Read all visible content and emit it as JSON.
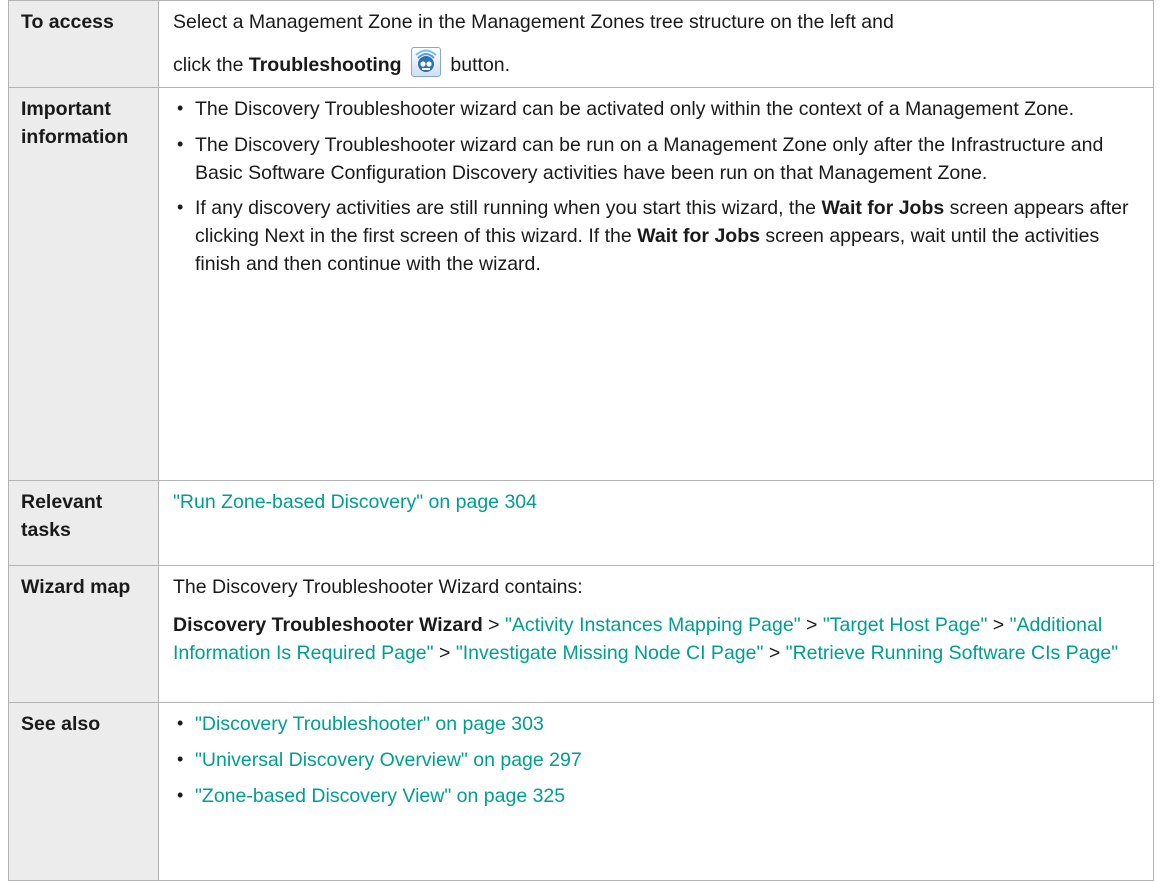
{
  "rows": {
    "access": {
      "label": "To access",
      "line1": "Select a Management Zone in the Management Zones tree structure on the left and",
      "line2_pre": "click the ",
      "line2_bold": "Troubleshooting",
      "line2_post": " button.",
      "icon": "troubleshooting-icon"
    },
    "important": {
      "label": "Important information",
      "bullet1": "The Discovery Troubleshooter wizard can be activated only within the context of a Management Zone.",
      "bullet2": "The Discovery Troubleshooter wizard can be run on a Management Zone only after the Infrastructure and Basic Software Configuration Discovery activities have been run on that Management Zone.",
      "bullet3_a": "If any discovery activities are still running when you start this wizard, the ",
      "bullet3_b": "Wait for Jobs",
      "bullet3_c": " screen appears after clicking Next in the first screen of this wizard. If the ",
      "bullet3_d": "Wait for Jobs",
      "bullet3_e": " screen appears, wait until the activities finish and then continue with the wizard."
    },
    "tasks": {
      "label": "Relevant tasks",
      "link": "\"Run Zone-based Discovery\" on page 304"
    },
    "wizard": {
      "label": "Wizard map",
      "intro": "The Discovery Troubleshooter Wizard contains:",
      "start": "Discovery Troubleshooter Wizard",
      "sep": " > ",
      "steps": [
        "\"Activity Instances Mapping Page\"",
        "\"Target Host Page\"",
        "\"Additional Information Is Required Page\"",
        "\"Investigate Missing Node CI Page\"",
        "\"Retrieve Running Software CIs Page\""
      ]
    },
    "see_also": {
      "label": "See also",
      "links": [
        "\"Discovery Troubleshooter\" on page 303",
        "\"Universal Discovery Overview\" on page 297",
        "\"Zone-based Discovery View\" on page 325"
      ]
    }
  },
  "colors": {
    "link": "#009e8e",
    "label_bg": "#ececec",
    "border": "#b3b3b3"
  }
}
